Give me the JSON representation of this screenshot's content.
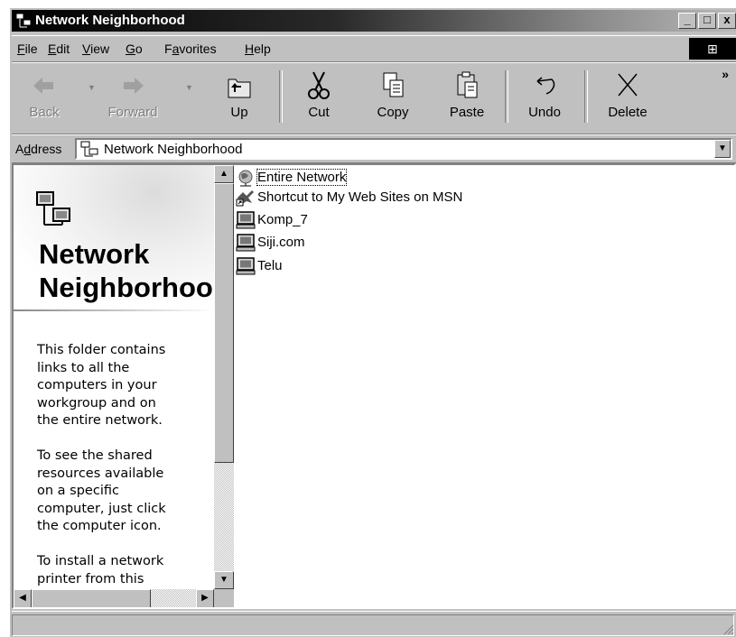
{
  "window": {
    "title": "Network Neighborhood",
    "controls": {
      "minimize": "_",
      "maximize": "□",
      "close": "x"
    }
  },
  "menubar": {
    "items": [
      {
        "label_pre": "",
        "label_key": "F",
        "label_post": "ile"
      },
      {
        "label_pre": "",
        "label_key": "E",
        "label_post": "dit"
      },
      {
        "label_pre": "",
        "label_key": "V",
        "label_post": "iew"
      },
      {
        "label_pre": "",
        "label_key": "G",
        "label_post": "o"
      },
      {
        "label_pre": "F",
        "label_key": "a",
        "label_post": "vorites"
      },
      {
        "label_pre": "",
        "label_key": "H",
        "label_post": "elp"
      }
    ]
  },
  "toolbar": {
    "back": "Back",
    "forward": "Forward",
    "up": "Up",
    "cut": "Cut",
    "copy": "Copy",
    "paste": "Paste",
    "undo": "Undo",
    "delete": "Delete",
    "more": "»"
  },
  "addressbar": {
    "label_pre": "A",
    "label_key": "d",
    "label_post": "dress",
    "value": "Network Neighborhood"
  },
  "leftpane": {
    "title_line1": "Network",
    "title_line2": "Neighborhood",
    "description": "This folder contains\nlinks to all the\ncomputers in your\nworkgroup and on\nthe entire network.\n\nTo see the shared\nresources available\non a specific\ncomputer, just click\nthe computer icon.\n\nTo install a network\nprinter from this"
  },
  "items": [
    {
      "label": "Entire Network",
      "icon": "globe-network-icon"
    },
    {
      "label": "Shortcut to My Web Sites on MSN",
      "icon": "web-folder-shortcut-icon"
    },
    {
      "label": "Komp_7",
      "icon": "computer-icon"
    },
    {
      "label": "Siji.com",
      "icon": "computer-icon"
    },
    {
      "label": "Telu",
      "icon": "computer-icon"
    }
  ],
  "statusbar": {
    "text": ""
  }
}
